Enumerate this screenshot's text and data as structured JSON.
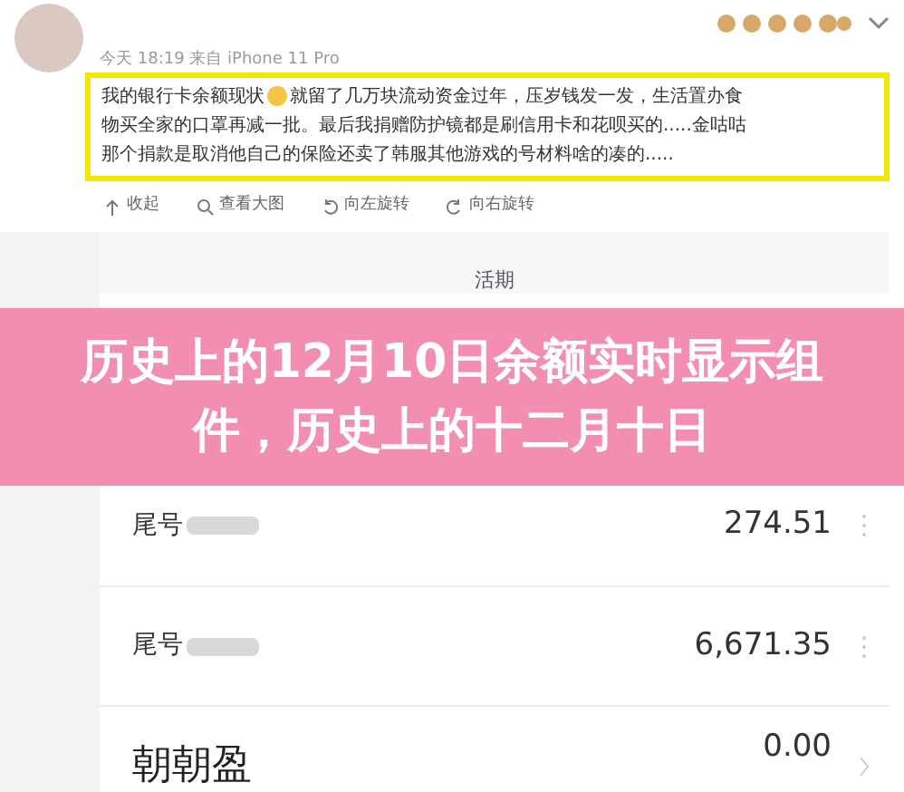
{
  "post": {
    "meta": "今天 18:19 来自 iPhone 11 Pro",
    "text_lines": [
      "我的银行卡余额现状",
      "就留了几万块流动资金过年，压岁钱发一发，生活置办食",
      "物买全家的口罩再减一批。最后我捐赠防护镜都是刷信用卡和花呗买的.....金咕咕",
      "那个捐款是取消他自己的保险还卖了韩服其他游戏的号材料啥的凑的....."
    ],
    "actions": [
      {
        "kind": "collapse",
        "label": "收起"
      },
      {
        "kind": "zoom",
        "label": "查看大图"
      },
      {
        "kind": "rotate-left",
        "label": "向左旋转"
      },
      {
        "kind": "rotate-right",
        "label": "向右旋转"
      }
    ]
  },
  "bank_app": {
    "tab": "活期",
    "rows": [
      {
        "kind": "card",
        "label": "尾号",
        "amount": "274.51"
      },
      {
        "kind": "card",
        "label": "尾号",
        "amount": "6,671.35"
      },
      {
        "kind": "product",
        "label": "朝朝盈",
        "amount": "0.00"
      }
    ]
  },
  "overlay_title": "历史上的12月10日余额实时显示组件，历史上的十二月十日"
}
